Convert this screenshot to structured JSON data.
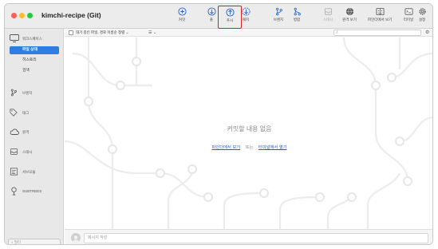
{
  "window": {
    "title": "kimchi-recipe (Git)"
  },
  "toolbar": {
    "buttons": [
      {
        "id": "commit",
        "label": "커밋",
        "icon": "commit-icon"
      },
      {
        "id": "pull",
        "label": "풀",
        "icon": "pull-icon"
      },
      {
        "id": "push",
        "label": "푸시",
        "icon": "push-icon"
      },
      {
        "id": "fetch",
        "label": "패치",
        "icon": "fetch-icon"
      },
      {
        "id": "branch",
        "label": "브랜치",
        "icon": "branch-icon"
      },
      {
        "id": "merge",
        "label": "병합",
        "icon": "merge-icon"
      },
      {
        "id": "stash",
        "label": "스태시",
        "icon": "stash-icon"
      },
      {
        "id": "remote",
        "label": "원격 보기",
        "icon": "globe-icon"
      },
      {
        "id": "finder",
        "label": "파인더에서 보기",
        "icon": "finder-icon"
      },
      {
        "id": "terminal",
        "label": "터미널",
        "icon": "terminal-icon"
      },
      {
        "id": "settings",
        "label": "설정",
        "icon": "gear-icon"
      }
    ],
    "highlighted": "push"
  },
  "sidebar": {
    "workspace_label": "워크스페이스",
    "workspace_items": [
      "파일 상태",
      "히스토리",
      "검색"
    ],
    "active_item": "파일 상태",
    "sections": [
      {
        "label": "브랜치",
        "icon": "branch-icon"
      },
      {
        "label": "태그",
        "icon": "tag-icon"
      },
      {
        "label": "원격",
        "icon": "cloud-icon"
      },
      {
        "label": "스태시",
        "icon": "stash-icon"
      },
      {
        "label": "서브모듈",
        "icon": "submodule-icon"
      },
      {
        "label": "SUBTREES",
        "icon": "subtree-icon"
      }
    ],
    "search_placeholder": "필터"
  },
  "filterbar": {
    "filter_text": "대기 중인 파일, 경로 이름순 정렬 ⌄"
  },
  "main": {
    "empty_message": "커밋할 내용 없음",
    "open_in_sourcetree": "파인더에서 보기",
    "separator": "또는",
    "open_in_terminal": "터미널에서 열기"
  },
  "commit": {
    "placeholder": "메시지 작성"
  },
  "colors": {
    "accent": "#2e7de1",
    "highlight": "#d62020",
    "link": "#1f5fc8"
  }
}
